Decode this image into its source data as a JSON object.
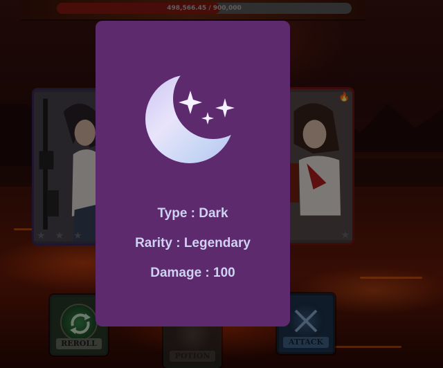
{
  "boss": {
    "hp_text": "498,566.45 / 900,000",
    "hp_fraction": 0.554
  },
  "cards": {
    "left": {
      "stars": 3
    },
    "right": {
      "element_icon": "flame-icon"
    }
  },
  "actions": {
    "reroll_label": "REROLL",
    "potion_label": "POTION",
    "attack_label": "ATTACK"
  },
  "modal": {
    "icon": "crescent-moon-stars-icon",
    "background_color": "#5e2a6e",
    "type_line": "Type : Dark",
    "rarity_line": "Rarity : Legendary",
    "damage_line": "Damage : 100"
  }
}
